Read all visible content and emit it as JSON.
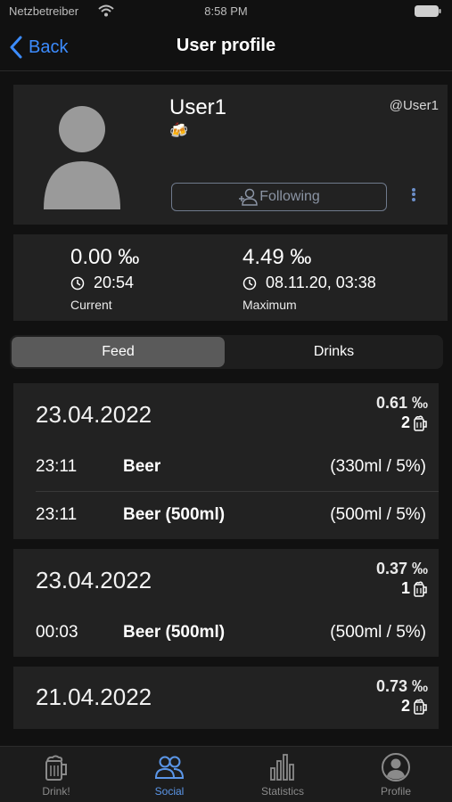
{
  "status_bar": {
    "carrier": "Netzbetreiber",
    "time": "8:58 PM"
  },
  "nav": {
    "back_label": "Back",
    "title": "User profile"
  },
  "profile": {
    "username": "User1",
    "emoji": "🍻",
    "handle": "@User1",
    "follow_button_label": "Following"
  },
  "stats": {
    "current": {
      "value": "0.00 ‰",
      "time": "20:54",
      "label": "Current"
    },
    "maximum": {
      "value": "4.49 ‰",
      "time": "08.11.20, 03:38",
      "label": "Maximum"
    }
  },
  "segments": {
    "selected": "Feed",
    "items": [
      "Feed",
      "Drinks"
    ]
  },
  "feed": [
    {
      "date": "23.04.2022",
      "promille": "0.61 ‰",
      "count": "2",
      "drinks": [
        {
          "time": "23:11",
          "name": "Beer",
          "detail": "(330ml / 5%)"
        },
        {
          "time": "23:11",
          "name": "Beer (500ml)",
          "detail": "(500ml / 5%)"
        }
      ]
    },
    {
      "date": "23.04.2022",
      "promille": "0.37 ‰",
      "count": "1",
      "drinks": [
        {
          "time": "00:03",
          "name": "Beer (500ml)",
          "detail": "(500ml / 5%)"
        }
      ]
    },
    {
      "date": "21.04.2022",
      "promille": "0.73 ‰",
      "count": "2",
      "drinks": []
    }
  ],
  "tab_bar": {
    "active": "Social",
    "items": [
      {
        "label": "Drink!",
        "icon": "beer-mug-icon"
      },
      {
        "label": "Social",
        "icon": "people-icon"
      },
      {
        "label": "Statistics",
        "icon": "bar-chart-icon"
      },
      {
        "label": "Profile",
        "icon": "person-circle-icon"
      }
    ]
  },
  "colors": {
    "accent": "#3c8cff",
    "tab_active": "#5b96e8",
    "card_background": "#222222",
    "page_background": "#111111"
  }
}
